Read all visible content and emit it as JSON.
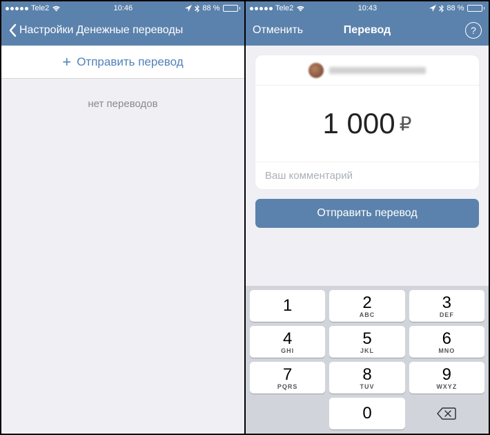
{
  "left": {
    "status": {
      "carrier": "Tele2",
      "time": "10:46",
      "battery_text": "88 %"
    },
    "nav": {
      "back_label": "Настройки",
      "title": "Денежные переводы"
    },
    "action_label": "Отправить перевод",
    "empty_label": "нет переводов"
  },
  "right": {
    "status": {
      "carrier": "Tele2",
      "time": "10:43",
      "battery_text": "88 %"
    },
    "nav": {
      "cancel_label": "Отменить",
      "title": "Перевод",
      "help_symbol": "?"
    },
    "amount_display": "1 000",
    "currency_symbol": "₽",
    "comment_placeholder": "Ваш комментарий",
    "send_label": "Отправить перевод",
    "keypad": {
      "keys": [
        [
          {
            "d": "1",
            "s": ""
          },
          {
            "d": "2",
            "s": "ABC"
          },
          {
            "d": "3",
            "s": "DEF"
          }
        ],
        [
          {
            "d": "4",
            "s": "GHI"
          },
          {
            "d": "5",
            "s": "JKL"
          },
          {
            "d": "6",
            "s": "MNO"
          }
        ],
        [
          {
            "d": "7",
            "s": "PQRS"
          },
          {
            "d": "8",
            "s": "TUV"
          },
          {
            "d": "9",
            "s": "WXYZ"
          }
        ]
      ],
      "zero": {
        "d": "0",
        "s": ""
      }
    }
  }
}
